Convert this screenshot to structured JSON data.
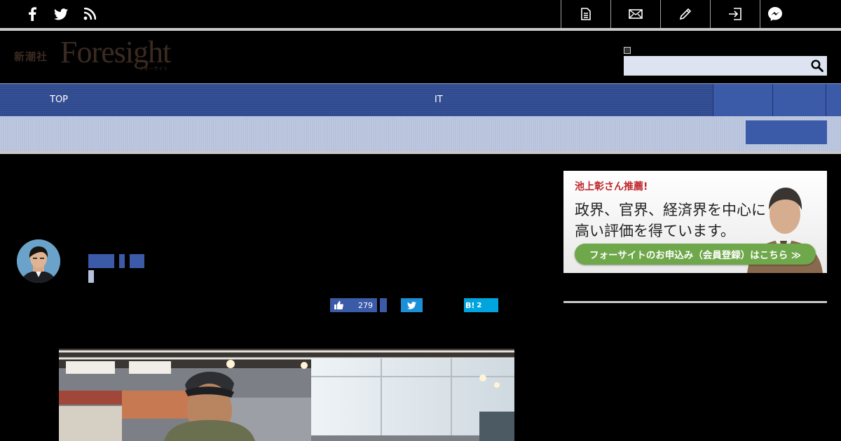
{
  "topbar": {
    "social_icons": [
      "facebook-icon",
      "twitter-icon",
      "rss-icon"
    ],
    "tool_icons": [
      "document-icon",
      "mail-icon",
      "pencil-icon",
      "login-icon",
      "messenger-icon"
    ]
  },
  "header": {
    "brand_ja": "新潮社",
    "brand_en": "Foresight",
    "brand_sub": "フォーサイト",
    "search": {
      "placeholder": "",
      "icon": "search-icon"
    }
  },
  "nav": {
    "items": [
      {
        "label": "TOP"
      },
      {
        "label": "IT"
      }
    ]
  },
  "social": {
    "like_count": "279",
    "hatena_label": "B!",
    "hatena_count": "2"
  },
  "ad": {
    "kicker": "池上彰さん推薦!",
    "line1": "政界、官界、経済界を中心に",
    "line2": "高い評価を得ています。",
    "cta": "フォーサイトのお申込み（会員登録）はこちら ≫"
  },
  "colors": {
    "nav_blue": "#2f4a8f",
    "block_blue": "#3b5aa8",
    "subbar": "#b6c2dc",
    "twitter": "#1d8fd8",
    "hatena": "#00a4de",
    "cta_green": "#6fa74b"
  }
}
